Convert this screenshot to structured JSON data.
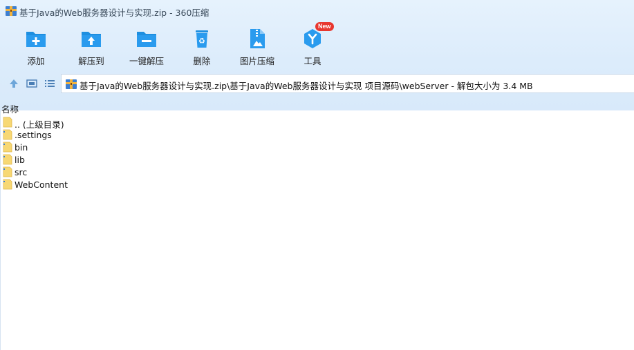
{
  "window": {
    "title": "基于Java的Web服务器设计与实现.zip - 360压缩"
  },
  "toolbar": {
    "items": [
      {
        "label": "添加",
        "icon": "add-folder-icon"
      },
      {
        "label": "解压到",
        "icon": "extract-to-icon"
      },
      {
        "label": "一键解压",
        "icon": "one-click-extract-icon"
      },
      {
        "label": "删除",
        "icon": "recycle-bin-icon"
      },
      {
        "label": "图片压缩",
        "icon": "image-compress-icon"
      },
      {
        "label": "工具",
        "icon": "tools-icon",
        "badge": "New"
      }
    ]
  },
  "navbar": {
    "path": "基于Java的Web服务器设计与实现.zip\\基于Java的Web服务器设计与实现 项目源码\\webServer - 解包大小为 3.4 MB"
  },
  "list": {
    "column_name": "名称",
    "rows": [
      {
        "name": ".. (上级目录)",
        "icon": "folder-icon"
      },
      {
        "name": ".settings",
        "icon": "folder-icon"
      },
      {
        "name": "bin",
        "icon": "folder-icon"
      },
      {
        "name": "lib",
        "icon": "folder-icon"
      },
      {
        "name": "src",
        "icon": "folder-icon"
      },
      {
        "name": "WebContent",
        "icon": "folder-icon"
      }
    ]
  },
  "colors": {
    "accent": "#1e8fe0",
    "toolbar_bg": "#dcecfb",
    "folder": "#f5cf5a",
    "badge": "#e8372f"
  }
}
